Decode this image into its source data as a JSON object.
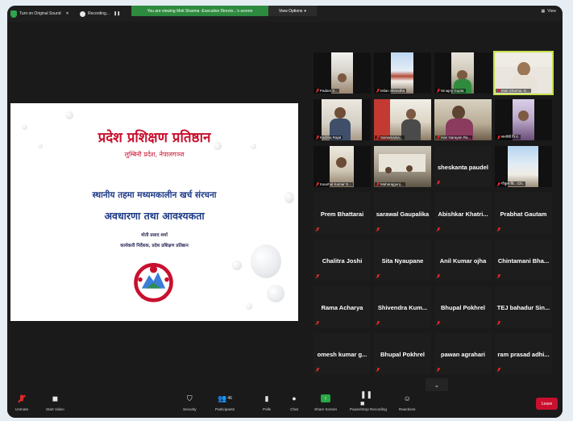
{
  "top_bar": {
    "original_sound": "Turn on Original Sound",
    "recording": "Recording...",
    "notice": "You are viewing Moti Sharma -Executive Directo...'s screen",
    "view_options": "View Options",
    "view": "View"
  },
  "slide": {
    "title": "प्रदेश प्रशिक्षण प्रतिष्ठान",
    "subtitle": "लुम्बिनी प्रदेश, नेपालगञ्ज",
    "heading1": "स्थानीय तहमा मध्यमकालीन खर्च संरचना",
    "heading2": "अवधारणा तथा आवश्यकता",
    "presenter": "मोती प्रसाद शर्मा",
    "role": "कार्यकारी निर्देशक, प्रदेश प्रशिक्षण प्रतिष्ठान"
  },
  "participants": [
    {
      "name": "Padam b...",
      "video": true
    },
    {
      "name": "Milan Shrestha",
      "video": true
    },
    {
      "name": "Ninajey Gupta",
      "video": true
    },
    {
      "name": "Moti Sharma -E...",
      "video": true,
      "active": true
    },
    {
      "name": "Karbha Rajat",
      "video": true
    },
    {
      "name": "Sainamaina...",
      "video": true
    },
    {
      "name": "Hari Narayan Ra...",
      "video": true
    },
    {
      "name": "सन्तोषी पि.ए.",
      "video": true
    },
    {
      "name": "Kaushal Kumar S...",
      "video": true
    },
    {
      "name": "Maharajgunj...",
      "video": true
    },
    {
      "name": "sheskanta paudel",
      "video": false
    },
    {
      "name": "गोकुल वि... Ch..",
      "video": true
    },
    {
      "name": "Prem Bhattarai",
      "video": false
    },
    {
      "name": "sarawal Gaupalika",
      "video": false
    },
    {
      "name": "Abishkar Khatri...",
      "video": false
    },
    {
      "name": "Prabhat Gautam",
      "video": false
    },
    {
      "name": "Chalitra Joshi",
      "video": false
    },
    {
      "name": "Sita Nyaupane",
      "video": false
    },
    {
      "name": "Anil Kumar ojha",
      "video": false
    },
    {
      "name": "Chintamani Bha...",
      "video": false
    },
    {
      "name": "Rama Acharya",
      "video": false
    },
    {
      "name": "Shivendra Kum...",
      "video": false
    },
    {
      "name": "Bhupal Pokhrel",
      "video": false
    },
    {
      "name": "TEJ bahadur Sin...",
      "video": false
    },
    {
      "name": "omesh kumar g...",
      "video": false
    },
    {
      "name": "Bhupal Pokhrel",
      "video": false
    },
    {
      "name": "pawan agrahari",
      "video": false
    },
    {
      "name": "ram prasad adhi...",
      "video": false
    }
  ],
  "toolbar": {
    "unmute": "Unmute",
    "start_video": "Start Video",
    "security": "Security",
    "participants": "Participants",
    "participants_count": "46",
    "polls": "Polls",
    "chat": "Chat",
    "share_screen": "Share Screen",
    "recording": "Pause/Stop Recording",
    "reactions": "Reactions",
    "leave": "Leave"
  },
  "colors": {
    "notice_green": "#2d8a3e",
    "active_speaker": "#c6e04b",
    "leave_red": "#c8102e",
    "slide_title_red": "#c8102e",
    "slide_heading_blue": "#1f3c88"
  }
}
